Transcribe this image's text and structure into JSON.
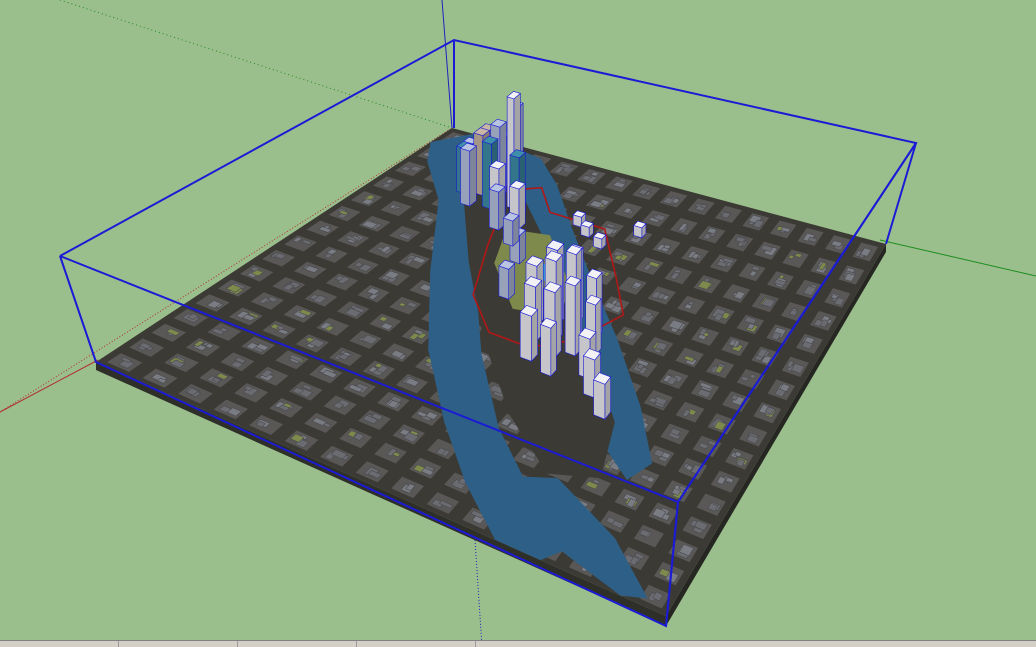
{
  "app": {
    "view": "3d-model-viewport"
  },
  "colors": {
    "background": "#9bbf8c",
    "selection_box": "#1b1bd6",
    "ground": "#4a4a44",
    "road": "#3c3a34",
    "block": "#595857",
    "roof": "#7a7c84",
    "water": "#2e5f86",
    "park": "#7d8a4c",
    "tower_light": "#f1f1f6",
    "tower_blue": "#b8c4e2",
    "tower_teal": "#3e8fa8",
    "tower_tan": "#c9b6a4",
    "boundary_line": "#b01818",
    "axis_red": "#b23030",
    "axis_green": "#1c8c1c",
    "axis_blue": "#2020c0"
  },
  "scene": {
    "model": "city-block-terrain",
    "selected": true,
    "axes": [
      "red-axis",
      "green-axis",
      "blue-axis"
    ]
  },
  "statusbar": {
    "segments": 4
  }
}
